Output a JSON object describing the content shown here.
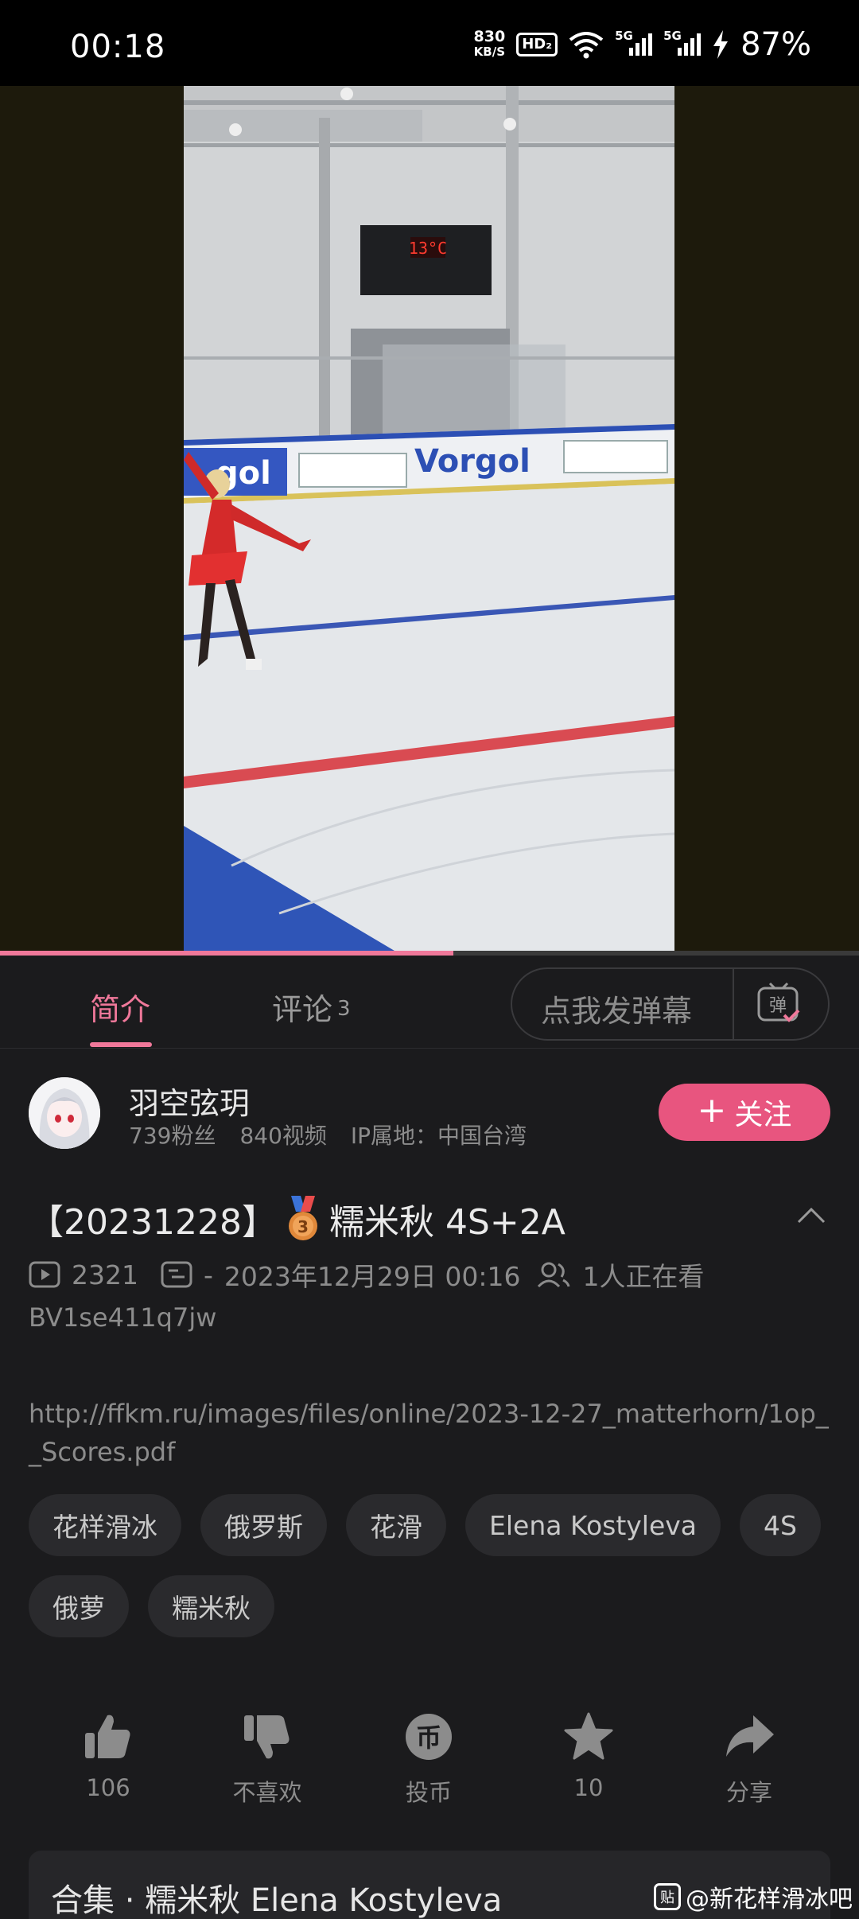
{
  "status_bar": {
    "time": "00:18",
    "net_speed_value": "830",
    "net_speed_unit": "KB/S",
    "hd_badge": "HD₂",
    "signal1": "5G",
    "signal2": "5G",
    "battery": "87%"
  },
  "video": {
    "progress": 0.528,
    "accent_color": "#f0789a",
    "scene": {
      "scoreboard_text": "13°C",
      "banner_brand": "Vorgol"
    }
  },
  "tabs": {
    "intro": "简介",
    "comments": "评论",
    "comments_count": "3",
    "danmaku_placeholder": "点我发弹幕",
    "danmaku_icon_label": "弹"
  },
  "uploader": {
    "name": "羽空弦玥",
    "fans": "739粉丝",
    "videos": "840视频",
    "ip": "IP属地：中国台湾",
    "follow_label": "关注",
    "follow_color": "#e8557f"
  },
  "video_info": {
    "title_prefix": "【20231228】",
    "title_text": "糯米秋 4S+2A",
    "views": "2321",
    "danmaku_count": "-",
    "date": "2023年12月29日 00:16",
    "watching": "1人正在看",
    "bvid": "BV1se411q7jw",
    "description": "http://ffkm.ru/images/files/online/2023-12-27_matterhorn/1op__Scores.pdf"
  },
  "tags": [
    "花样滑冰",
    "俄罗斯",
    "花滑",
    "Elena Kostyleva",
    "4S",
    "俄萝",
    "糯米秋"
  ],
  "actions": {
    "like": "106",
    "dislike": "不喜欢",
    "coin": "投币",
    "favorite": "10",
    "share": "分享"
  },
  "collection": {
    "label": "合集 · 糯米秋 Elena Kostyleva"
  },
  "watermark": {
    "badge": "贴",
    "text": "@新花样滑冰吧"
  }
}
